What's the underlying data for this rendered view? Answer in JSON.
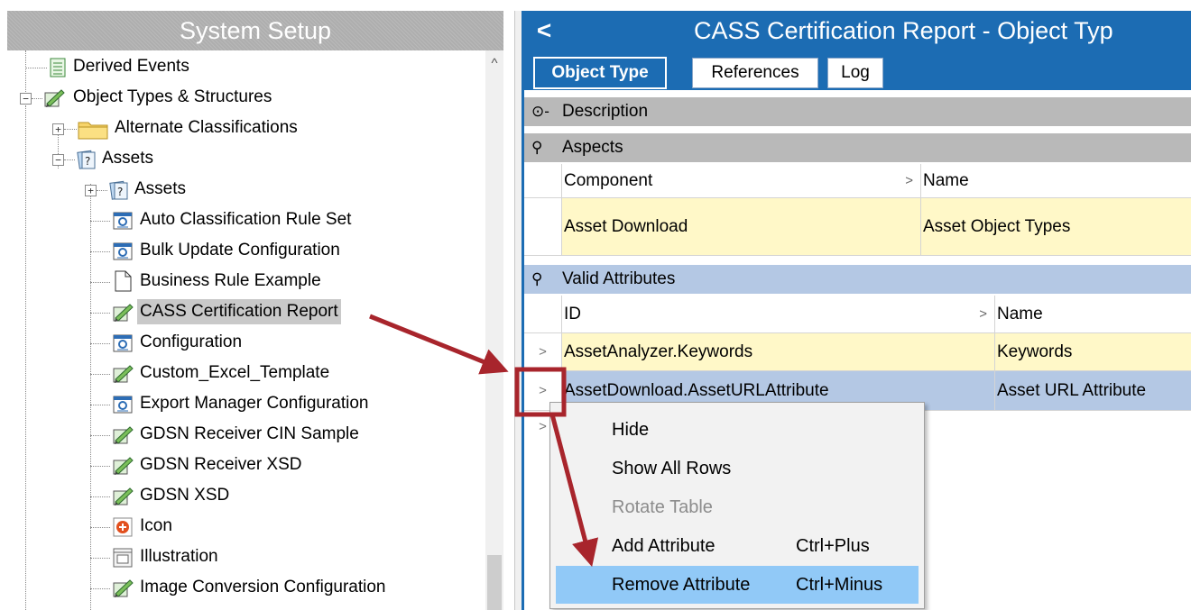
{
  "left_panel": {
    "title": "System Setup",
    "tree": [
      {
        "label": "Derived Events",
        "icon": "list-icon"
      },
      {
        "label": "Object Types & Structures",
        "icon": "object-type-icon"
      },
      {
        "label": "Alternate Classifications",
        "icon": "folder-icon"
      },
      {
        "label": "Assets",
        "icon": "asset-type-icon"
      },
      {
        "label": "Assets",
        "icon": "asset-type-icon"
      },
      {
        "label": "Auto Classification Rule Set",
        "icon": "config-icon"
      },
      {
        "label": "Bulk Update Configuration",
        "icon": "config-icon"
      },
      {
        "label": "Business Rule Example",
        "icon": "document-icon"
      },
      {
        "label": "CASS Certification Report",
        "icon": "object-type-icon"
      },
      {
        "label": "Configuration",
        "icon": "config-icon"
      },
      {
        "label": "Custom_Excel_Template",
        "icon": "object-type-icon"
      },
      {
        "label": "Export Manager Configuration",
        "icon": "config-icon"
      },
      {
        "label": "GDSN Receiver CIN Sample",
        "icon": "object-type-icon"
      },
      {
        "label": "GDSN Receiver XSD",
        "icon": "object-type-icon"
      },
      {
        "label": "GDSN XSD",
        "icon": "object-type-icon"
      },
      {
        "label": "Icon",
        "icon": "icon-type-icon"
      },
      {
        "label": "Illustration",
        "icon": "illustration-icon"
      },
      {
        "label": "Image Conversion Configuration",
        "icon": "object-type-icon"
      }
    ]
  },
  "right_panel": {
    "title": "CASS Certification Report - Object Typ",
    "tabs": [
      "Object Type",
      "References",
      "Log"
    ],
    "active_tab": "Object Type",
    "sections": {
      "description": "Description",
      "aspects": "Aspects",
      "valid_attributes": "Valid Attributes"
    },
    "aspects_table": {
      "columns": [
        "Component",
        "Name"
      ],
      "rows": [
        [
          "Asset Download",
          "Asset Object Types"
        ]
      ]
    },
    "attributes_table": {
      "columns": [
        "ID",
        "Name"
      ],
      "rows": [
        [
          "AssetAnalyzer.Keywords",
          "Keywords"
        ],
        [
          "AssetDownload.AssetURLAttribute",
          "Asset URL Attribute"
        ]
      ]
    }
  },
  "context_menu": {
    "items": [
      {
        "label": "Hide",
        "shortcut": "",
        "enabled": true
      },
      {
        "label": "Show All Rows",
        "shortcut": "",
        "enabled": true
      },
      {
        "label": "Rotate Table",
        "shortcut": "",
        "enabled": false
      },
      {
        "label": "Add Attribute",
        "shortcut": "Ctrl+Plus",
        "enabled": true
      },
      {
        "label": "Remove Attribute",
        "shortcut": "Ctrl+Minus",
        "enabled": true
      }
    ],
    "highlighted": "Remove Attribute"
  },
  "colors": {
    "header_blue": "#1c6cb3",
    "annotation_red": "#a8252c",
    "row_yellow": "#fff8c8",
    "row_selected": "#b4c8e4",
    "menu_hover": "#91c9f7"
  }
}
